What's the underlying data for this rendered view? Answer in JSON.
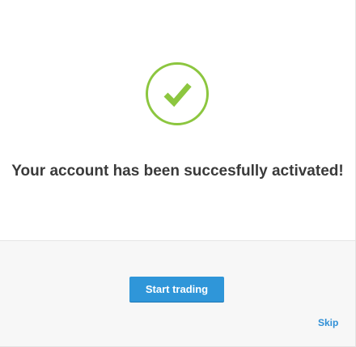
{
  "dialog": {
    "icon": "checkmark-circle-icon",
    "accent_color": "#8cc63f",
    "title": "Your account has been succesfully activated!",
    "primary_button_label": "Start trading",
    "primary_button_color": "#2f96d9",
    "skip_label": "Skip",
    "link_color": "#2f8fd6"
  }
}
